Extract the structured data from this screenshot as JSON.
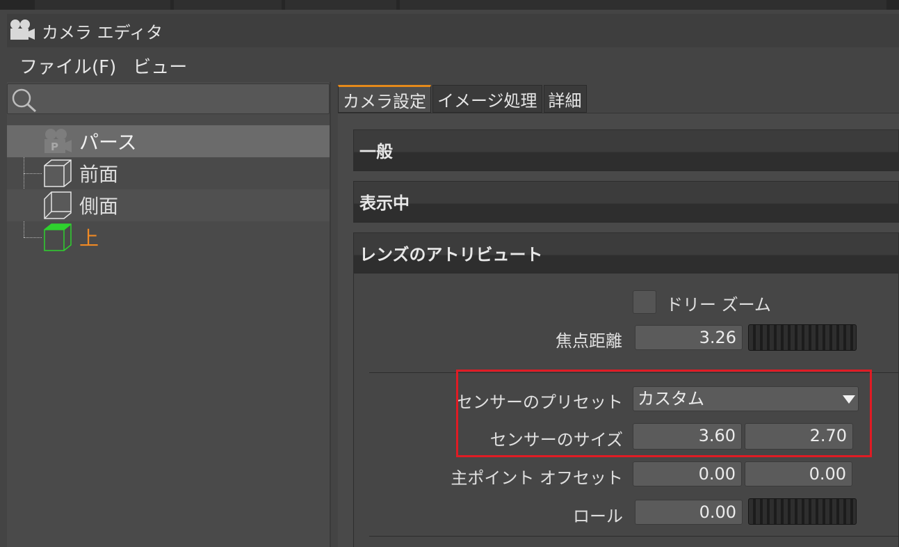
{
  "window": {
    "title": "カメラ エディタ"
  },
  "menu": {
    "file": "ファイル(F)",
    "view": "ビュー"
  },
  "search": {
    "placeholder": ""
  },
  "tree": {
    "items": [
      {
        "label": "パース",
        "state": "selected"
      },
      {
        "label": "前面",
        "state": "normal"
      },
      {
        "label": "側面",
        "state": "normal"
      },
      {
        "label": "上",
        "state": "active"
      }
    ]
  },
  "tabs": {
    "camera_settings": "カメラ設定",
    "image_processing": "イメージ処理",
    "details": "詳細"
  },
  "sections": {
    "general": "一般",
    "display": "表示中",
    "lens": "レンズのアトリビュート"
  },
  "lens": {
    "dolly_zoom_label": "ドリー ズーム",
    "focal_length_label": "焦点距離",
    "focal_length_value": "3.26",
    "sensor_preset_label": "センサーのプリセット",
    "sensor_preset_value": "カスタム",
    "sensor_size_label": "センサーのサイズ",
    "sensor_size_w": "3.60",
    "sensor_size_h": "2.70",
    "principal_offset_label": "主ポイント オフセット",
    "principal_offset_x": "0.00",
    "principal_offset_y": "0.00",
    "roll_label": "ロール",
    "roll_value": "0.00"
  },
  "colors": {
    "accent_tab": "#e58a1b",
    "active_item": "#f08a24",
    "highlight_box": "#e01b24",
    "top_cube": "#2ed12e"
  }
}
